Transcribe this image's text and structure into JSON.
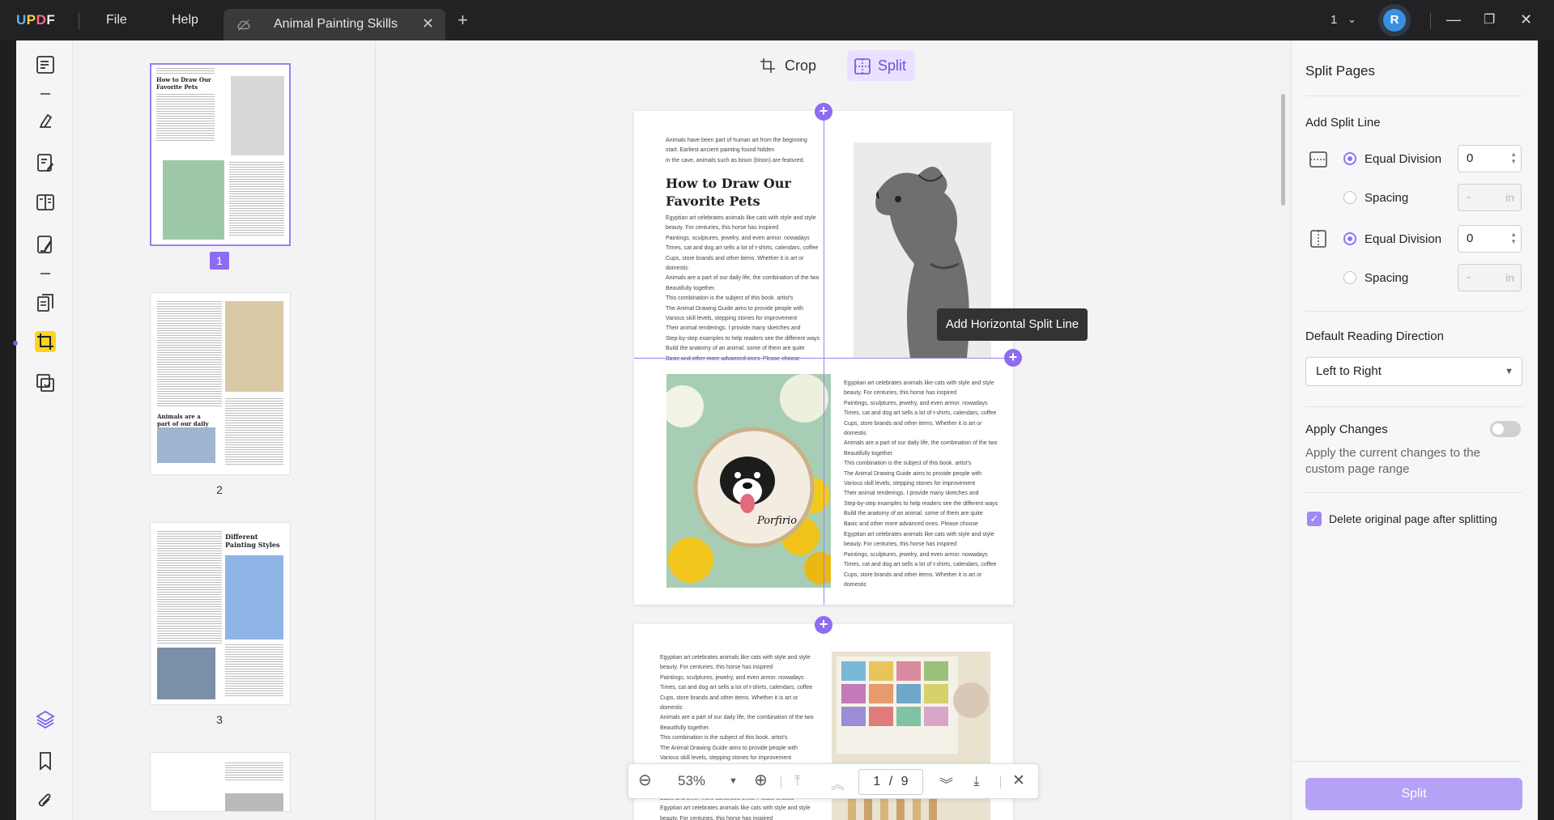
{
  "app": {
    "logo": "UPDF"
  },
  "menu": {
    "file": "File",
    "help": "Help"
  },
  "tab": {
    "title": "Animal Painting Skills"
  },
  "titlebar": {
    "page_indicator": "1",
    "avatar_initial": "R"
  },
  "toolbar": {
    "crop_label": "Crop",
    "split_label": "Split"
  },
  "thumbnails": [
    {
      "page": "1",
      "heading": "How to Draw Our Favorite Pets"
    },
    {
      "page": "2",
      "heading": "Animals are a part of our daily life"
    },
    {
      "page": "3",
      "heading": "Different Painting Styles"
    }
  ],
  "page1": {
    "intro": "Animals have been part of human art from the beginning\nstart. Earliest ancient painting found hidden\nin the cave, animals such as bison (bison) are featured.",
    "heading": "How to Draw Our Favorite Pets",
    "body_left": "Egyptian art celebrates animals like cats with style and style\nbeauty. For centuries, this horse has inspired\nPaintings, sculptures, jewelry, and even armor. nowadays\nTimes, cat and dog art sells a lot of t-shirts, calendars, coffee\nCups, store brands and other items. Whether it is art or domestic\nAnimals are a part of our daily life, the combination of the two\nBeautifully together.\nThis combination is the subject of this book. artist's\nThe Animal Drawing Guide aims to provide people with\nVarious skill levels, stepping stones for improvement\nTheir animal renderings. I provide many sketches and\nStep-by-step examples to help readers see the different ways\nBuild the anatomy of an animal. some of them are quite\nBasic and other more advanced ones. Please choose",
    "body_right_1": "Egyptian art celebrates animals like cats with style and style\nbeauty. For centuries, this horse has inspired\nPaintings, sculptures, jewelry, and even armor. nowadays\nTimes, cat and dog art sells a lot of t-shirts, calendars, coffee\nCups, store brands and other items. Whether it is art or domestic\nAnimals are a part of our daily life, the combination of the two\nBeautifully together.\nThis combination is the subject of this book. artist's\nThe Animal Drawing Guide aims to provide people with\nVarious skill levels, stepping stones for improvement\nTheir animal renderings. I provide many sketches and\nStep-by-step examples to help readers see the different ways\nBuild the anatomy of an animal. some of them are quite\nBasic and other more advanced ones. Please choose",
    "body_right_2": "Egyptian art celebrates animals like cats with style and style\nbeauty. For centuries, this horse has inspired\nPaintings, sculptures, jewelry, and even armor. nowadays\nTimes, cat and dog art sells a lot of t-shirts, calendars, coffee\nCups, store brands and other items. Whether it is art or domestic",
    "embroidery_text": "Porfirio"
  },
  "page2": {
    "body": "Egyptian art celebrates animals like cats with style and style\nbeauty. For centuries, this horse has inspired\nPaintings, sculptures, jewelry, and even armor. nowadays\nTimes, cat and dog art sells a lot of t-shirts, calendars, coffee\nCups, store brands and other items. Whether it is art or domestic\nAnimals are a part of our daily life, the combination of the two\nBeautifully together.\nThis combination is the subject of this book. artist's\nThe Animal Drawing Guide aims to provide people with\nVarious skill levels, stepping stones for improvement\nTheir animal renderings. I provide many sketches and\nStep-by-step examples to help readers see the different ways\nBuild the anatomy of an animal. some of them are quite\nBasic and other more advanced ones. Please choose\nEgyptian art celebrates animals like cats with style and style\nbeauty. For centuries, this horse has inspired\nPaintings, sculptures, jewelry, and even armor. nowadays"
  },
  "tooltip": "Add Horizontal Split Line",
  "nav": {
    "zoom": "53%",
    "current_page": "1",
    "separator": "/",
    "total_pages": "9"
  },
  "panel": {
    "title": "Split Pages",
    "add_split_line": "Add Split Line",
    "vertical": {
      "equal_division": "Equal Division",
      "equal_value": "0",
      "spacing": "Spacing",
      "spacing_value": "-",
      "unit": "in"
    },
    "horizontal": {
      "equal_division": "Equal Division",
      "equal_value": "0",
      "spacing": "Spacing",
      "spacing_value": "-",
      "unit": "in"
    },
    "reading_direction_label": "Default Reading Direction",
    "reading_direction_value": "Left to Right",
    "apply_changes_label": "Apply Changes",
    "apply_changes_desc": "Apply the current changes to the custom page range",
    "delete_original_label": "Delete original page after splitting",
    "split_button": "Split"
  },
  "colors": {
    "accent": "#8f6cf2",
    "active_tool": "#ffd21f"
  }
}
